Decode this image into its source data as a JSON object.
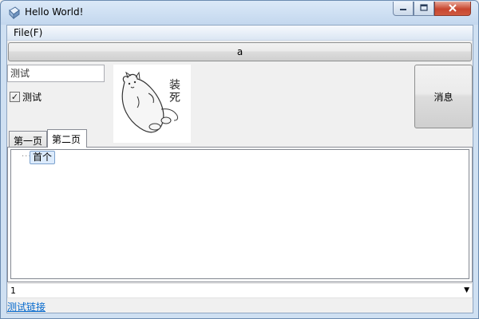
{
  "window": {
    "title": "Hello World!",
    "app_icon": "app-icon",
    "caption_buttons": [
      "minimize-icon",
      "maximize-icon",
      "close-icon"
    ],
    "close_color": "#c7462f"
  },
  "menu": {
    "items": [
      {
        "label": "File(F)"
      }
    ]
  },
  "toolbar": {
    "wide_button_label": "a"
  },
  "text_input": {
    "value": "测试"
  },
  "checkbox": {
    "label": "测试",
    "checked": true,
    "check_glyph": "✓"
  },
  "picture": {
    "icon": "cartoon-cat-icon",
    "caption": "装死"
  },
  "message_button": {
    "label": "消息"
  },
  "tabs": [
    {
      "label": "第一页",
      "selected": false
    },
    {
      "label": "第二页",
      "selected": true
    }
  ],
  "tree": {
    "connector": "···",
    "items": [
      {
        "label": "首个",
        "selected": true
      }
    ]
  },
  "combo": {
    "value": "1",
    "arrow": "▼"
  },
  "link": {
    "label": "测试链接",
    "color": "#0066cc"
  }
}
